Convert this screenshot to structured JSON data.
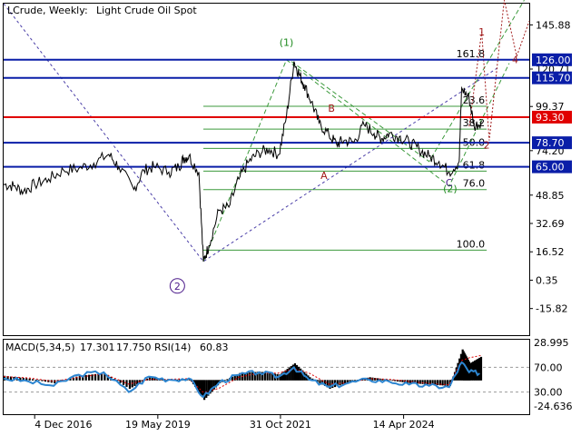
{
  "header": {
    "symbol": "LCrude, Weekly:",
    "description": "Light Crude Oil Spot"
  },
  "colors": {
    "blue_level": "#0a1ea8",
    "red_level": "#e00000",
    "fib_green": "#3c9a3c",
    "price": "#000000",
    "wave_green": "#1e8a1e",
    "wave_red": "#a01818",
    "wave_purple": "#4b1a8a",
    "trend_purple": "#4b3fa8",
    "macd_line": "#2c85d0",
    "signal_line": "#e00000"
  },
  "chart_data": [
    {
      "type": "line",
      "title": "LCrude, Weekly: Light Crude Oil Spot",
      "ylim": [
        -31.0,
        158.0
      ],
      "y_ticks": [
        "145.88",
        "120.71",
        "99.37",
        "74.20",
        "48.85",
        "32.69",
        "16.52",
        "0.35",
        "-15.82"
      ],
      "y_tick_values": [
        145.88,
        120.71,
        99.37,
        74.2,
        48.85,
        32.69,
        16.52,
        0.35,
        -15.82
      ],
      "x_ticks": [
        "4 Dec 2016",
        "19 May 2019",
        "31 Oct 2021",
        "14 Apr 2024"
      ],
      "x_tick_values": [
        2016.92,
        2019.38,
        2021.83,
        2024.29
      ],
      "xlim": [
        2016.3,
        2026.8
      ],
      "series": [
        {
          "x": [
            2016.3,
            2016.5,
            2016.7,
            2016.92,
            2017.2,
            2017.5,
            2017.8,
            2018.1,
            2018.4,
            2018.6,
            2018.9,
            2019.1,
            2019.3,
            2019.6,
            2019.8,
            2019.9,
            2020.0,
            2020.2,
            2020.29,
            2020.4,
            2020.6,
            2020.8,
            2021.0,
            2021.2,
            2021.4,
            2021.6,
            2021.8,
            2021.95,
            2022.1,
            2022.2,
            2022.3,
            2022.45,
            2022.6,
            2022.8,
            2022.95,
            2023.1,
            2023.3,
            2023.5,
            2023.7,
            2023.85,
            2024.0,
            2024.2,
            2024.4,
            2024.6,
            2024.8,
            2025.0,
            2025.2,
            2025.4,
            2025.45,
            2025.6,
            2025.7,
            2025.85
          ],
          "y": [
            55.0,
            54.0,
            51.0,
            55.0,
            58.0,
            63.0,
            64.0,
            67.0,
            72.0,
            65.0,
            52.0,
            63.0,
            65.0,
            62.0,
            65.0,
            70.0,
            71.0,
            62.0,
            11.0,
            20.0,
            40.0,
            42.0,
            58.0,
            68.0,
            73.0,
            75.0,
            72.0,
            94.0,
            125.0,
            118.0,
            112.0,
            102.0,
            90.0,
            83.0,
            78.0,
            80.0,
            79.0,
            89.0,
            84.0,
            81.0,
            84.0,
            82.0,
            79.0,
            75.0,
            71.0,
            68.0,
            62.0,
            68.0,
            110.0,
            104.0,
            88.0,
            91.0
          ]
        }
      ],
      "horizontal_levels": [
        {
          "value": 126.0,
          "label": "126.00",
          "color": "#0a1ea8"
        },
        {
          "value": 115.7,
          "label": "115.70",
          "color": "#0a1ea8"
        },
        {
          "value": 93.3,
          "label": "93.30",
          "color": "#e00000"
        },
        {
          "value": 78.7,
          "label": "78.70",
          "color": "#0a1ea8"
        },
        {
          "value": 65.0,
          "label": "65.00",
          "color": "#0a1ea8"
        }
      ],
      "fibonacci": [
        {
          "label": "161.8",
          "value": 126.0
        },
        {
          "label": "23.6",
          "value": 99.5
        },
        {
          "label": "38.2",
          "value": 86.5
        },
        {
          "label": "50.0",
          "value": 75.5
        },
        {
          "label": "61.8",
          "value": 62.5
        },
        {
          "label": "76.0",
          "value": 52.0
        },
        {
          "label": "100.0",
          "value": 17.5
        }
      ],
      "wave_labels": [
        {
          "text": "(1)",
          "x": 2021.95,
          "y": 134.0,
          "style": "green"
        },
        {
          "text": "(2)",
          "x": 2025.22,
          "y": 50.5,
          "style": "green"
        },
        {
          "text": "B",
          "x": 2022.85,
          "y": 96.5,
          "style": "red"
        },
        {
          "text": "A",
          "x": 2022.7,
          "y": 58.0,
          "style": "red"
        },
        {
          "text": "C",
          "x": 2025.2,
          "y": 54.0,
          "style": "purple"
        },
        {
          "text": "1",
          "x": 2025.85,
          "y": 140.0,
          "style": "red"
        },
        {
          "text": "2",
          "x": 2025.95,
          "y": 75.5,
          "style": "red"
        },
        {
          "text": "4",
          "x": 2026.52,
          "y": 124.0,
          "style": "red"
        },
        {
          "text": "2",
          "x": 2019.77,
          "y": -5.0,
          "style": "purple_circle"
        }
      ]
    },
    {
      "type": "line",
      "title": "MACD(5,34,5) 17.301 17.750 RSI(14) 60.83",
      "ylim": [
        -24.636,
        28.995
      ],
      "y_ticks": [
        "28.995",
        "70.00",
        "30.00",
        "-24.636"
      ],
      "macd_name": "MACD(5,34,5)",
      "macd_value": "17.301",
      "signal_value": "17.750",
      "rsi_name": "RSI(14)",
      "rsi_value": "60.83",
      "series": [
        {
          "name": "MACD",
          "x": [
            2016.3,
            2016.8,
            2017.3,
            2017.8,
            2018.3,
            2018.8,
            2019.2,
            2019.6,
            2020.0,
            2020.29,
            2020.6,
            2021.0,
            2021.4,
            2021.8,
            2022.1,
            2022.4,
            2022.8,
            2023.2,
            2023.6,
            2024.0,
            2024.4,
            2024.8,
            2025.2,
            2025.45,
            2025.6,
            2025.85
          ],
          "values": [
            3.0,
            1.0,
            -2.0,
            3.0,
            5.0,
            -6.0,
            2.0,
            0.0,
            1.0,
            -14.0,
            -2.0,
            5.0,
            6.0,
            4.0,
            12.0,
            2.0,
            -6.0,
            -1.0,
            2.0,
            0.0,
            -2.0,
            -3.0,
            -4.0,
            22.0,
            12.0,
            17.3
          ]
        },
        {
          "name": "Signal",
          "x": [
            2016.3,
            2016.8,
            2017.3,
            2017.8,
            2018.3,
            2018.8,
            2019.2,
            2019.6,
            2020.0,
            2020.29,
            2020.6,
            2021.0,
            2021.4,
            2021.8,
            2022.1,
            2022.4,
            2022.8,
            2023.2,
            2023.6,
            2024.0,
            2024.4,
            2024.8,
            2025.2,
            2025.45,
            2025.6,
            2025.85
          ],
          "values": [
            2.5,
            1.5,
            -1.0,
            2.0,
            4.5,
            -3.0,
            0.5,
            0.5,
            1.0,
            -9.0,
            -6.0,
            2.0,
            5.0,
            5.0,
            8.0,
            5.0,
            -3.0,
            -2.0,
            1.0,
            0.5,
            -1.0,
            -2.5,
            -3.5,
            14.0,
            16.0,
            17.75
          ]
        }
      ],
      "rsi": {
        "x": [
          2016.3,
          2016.8,
          2017.3,
          2017.8,
          2018.3,
          2018.8,
          2019.2,
          2019.6,
          2020.0,
          2020.29,
          2020.6,
          2021.0,
          2021.4,
          2021.8,
          2022.1,
          2022.4,
          2022.8,
          2023.2,
          2023.6,
          2024.0,
          2024.4,
          2024.8,
          2025.2,
          2025.45,
          2025.6,
          2025.85
        ],
        "values": [
          52,
          47,
          40,
          58,
          62,
          30,
          55,
          50,
          52,
          22,
          45,
          58,
          62,
          55,
          70,
          50,
          38,
          45,
          50,
          47,
          42,
          40,
          38,
          78,
          62,
          60.83
        ]
      }
    }
  ]
}
